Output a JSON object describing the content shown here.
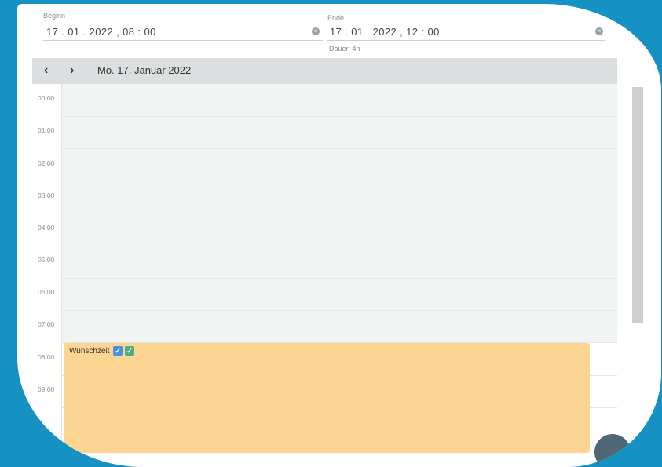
{
  "start": {
    "label": "Beginn",
    "value": "17 . 01 . 2022 ,  08 : 00"
  },
  "end": {
    "label": "Ende",
    "value": "17 . 01 . 2022 ,  12 : 00"
  },
  "duration": "Dauer: 4h",
  "calendar": {
    "prev": "‹",
    "next": "›",
    "date": "Mo. 17. Januar 2022",
    "hours": [
      "00:00",
      "01:00",
      "02:00",
      "03:00",
      "04:00",
      "05:00",
      "06:00",
      "07:00",
      "08:00",
      "09:00"
    ]
  },
  "event": {
    "title": "Wunschzeit",
    "check": "✓",
    "colors": [
      "#4a90e2",
      "#4caf7d"
    ],
    "fill": "#fdd592"
  },
  "colors": {
    "background": "#1592c2",
    "header": "#dcdfe0",
    "grid": "#f0f4f3"
  }
}
